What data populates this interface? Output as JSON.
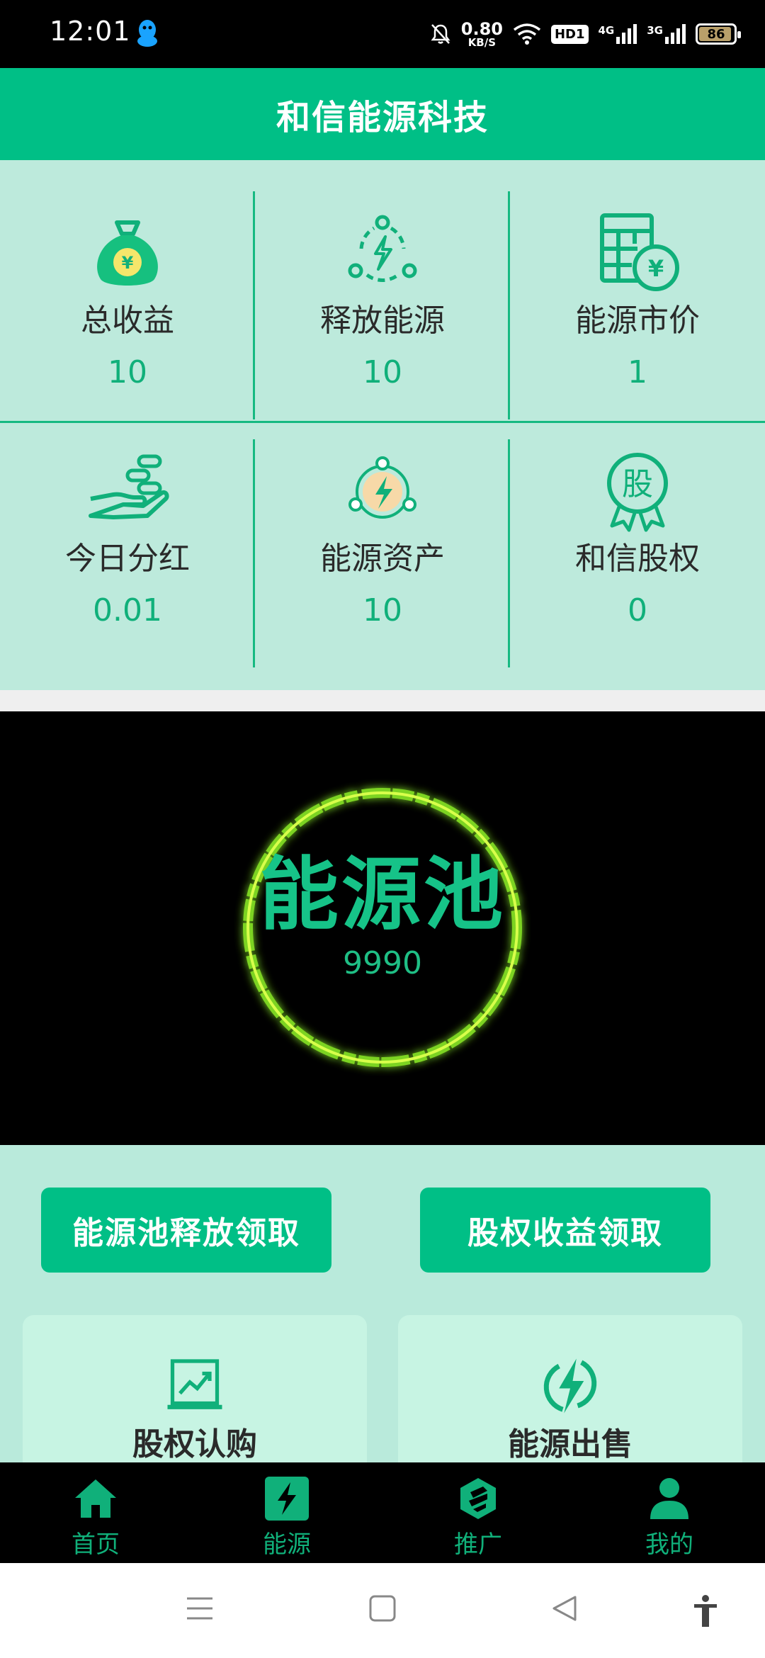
{
  "status_bar": {
    "time": "12:01",
    "speed_value": "0.80",
    "speed_unit": "KB/S",
    "hd_label": "HD1",
    "net1": "4G",
    "net2": "3G",
    "battery": "86",
    "battery_level_percent": 86
  },
  "header": {
    "title": "和信能源科技"
  },
  "stats": [
    {
      "label": "总收益",
      "value": "10",
      "icon": "money-bag-icon"
    },
    {
      "label": "释放能源",
      "value": "10",
      "icon": "energy-release-icon"
    },
    {
      "label": "能源市价",
      "value": "1",
      "icon": "calculator-yuan-icon"
    },
    {
      "label": "今日分红",
      "value": "0.01",
      "icon": "hand-coins-icon"
    },
    {
      "label": "能源资产",
      "value": "10",
      "icon": "energy-asset-icon"
    },
    {
      "label": "和信股权",
      "value": "0",
      "icon": "equity-medal-icon"
    }
  ],
  "pool": {
    "title": "能源池",
    "value": "9990"
  },
  "actions": {
    "release_claim": "能源池释放领取",
    "equity_claim": "股权收益领取"
  },
  "cards": [
    {
      "label": "股权认购",
      "icon": "chart-board-icon"
    },
    {
      "label": "能源出售",
      "icon": "lightning-circle-icon"
    }
  ],
  "nav": [
    {
      "label": "首页",
      "icon": "home-icon"
    },
    {
      "label": "能源",
      "icon": "energy-icon"
    },
    {
      "label": "推广",
      "icon": "promote-icon"
    },
    {
      "label": "我的",
      "icon": "user-icon"
    }
  ],
  "colors": {
    "accent": "#00bf86",
    "panel": "#bdeadc",
    "label_value": "#10b07a"
  }
}
